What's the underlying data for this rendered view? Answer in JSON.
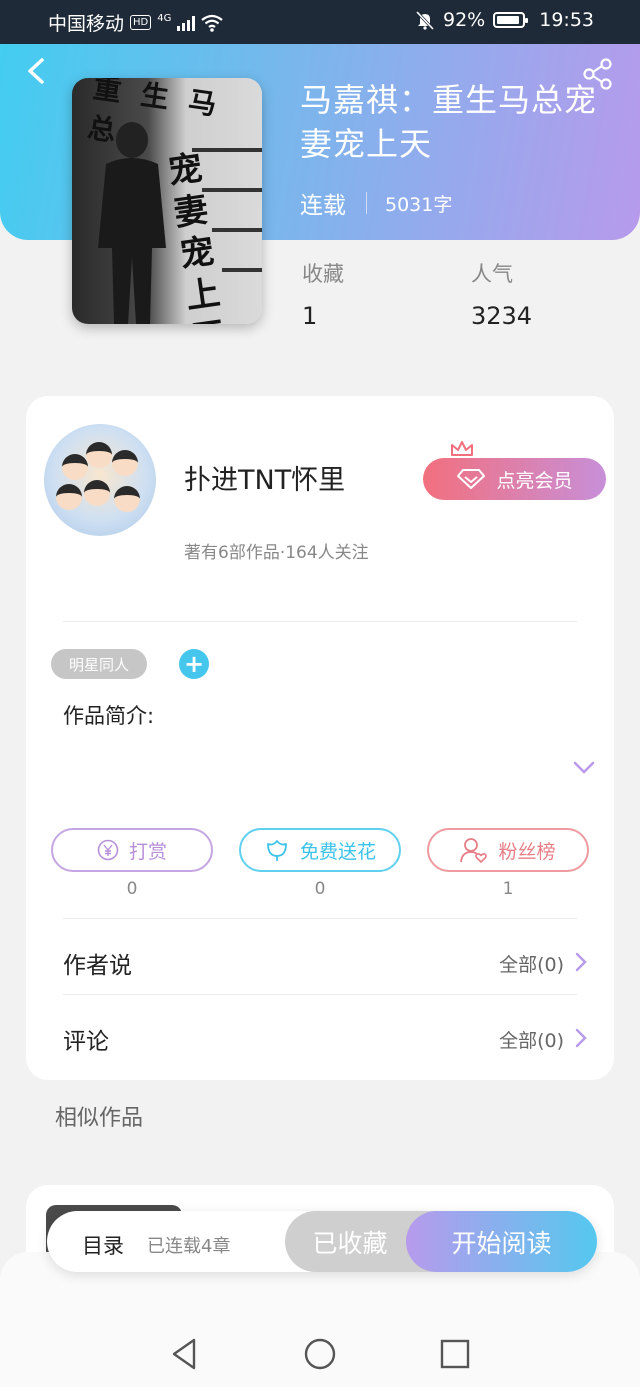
{
  "status_bar": {
    "carrier": "中国移动",
    "hd": "HD",
    "network": "4G",
    "battery": "92%",
    "time": "19:53"
  },
  "book": {
    "title": "马嘉祺：重生马总宠妻宠上天",
    "cover_title": "重生马总",
    "cover_text": "宠妻宠上天",
    "status": "连载",
    "word_count": "5031字",
    "favorites_label": "收藏",
    "favorites_value": "1",
    "popularity_label": "人气",
    "popularity_value": "3234"
  },
  "author": {
    "name": "扑进TNT怀里",
    "meta": "著有6部作品·164人关注",
    "vip_label": "点亮会员"
  },
  "tags": [
    "明星同人"
  ],
  "intro_label": "作品简介:",
  "actions": [
    {
      "label": "打赏",
      "count": "0"
    },
    {
      "label": "免费送花",
      "count": "0"
    },
    {
      "label": "粉丝榜",
      "count": "1"
    }
  ],
  "rows": {
    "author_says": {
      "title": "作者说",
      "more": "全部(0)"
    },
    "comments": {
      "title": "评论",
      "more": "全部(0)"
    }
  },
  "similar_title": "相似作品",
  "bottom_bar": {
    "toc_label": "目录",
    "toc_status": "已连载4章",
    "fav_button": "已收藏",
    "read_button": "开始阅读"
  },
  "colors": {
    "header_start": "#43cdf0",
    "header_end": "#b79aec",
    "accent_blue": "#45c6ec",
    "accent_purple": "#b78fd9",
    "accent_red": "#e77e86"
  }
}
